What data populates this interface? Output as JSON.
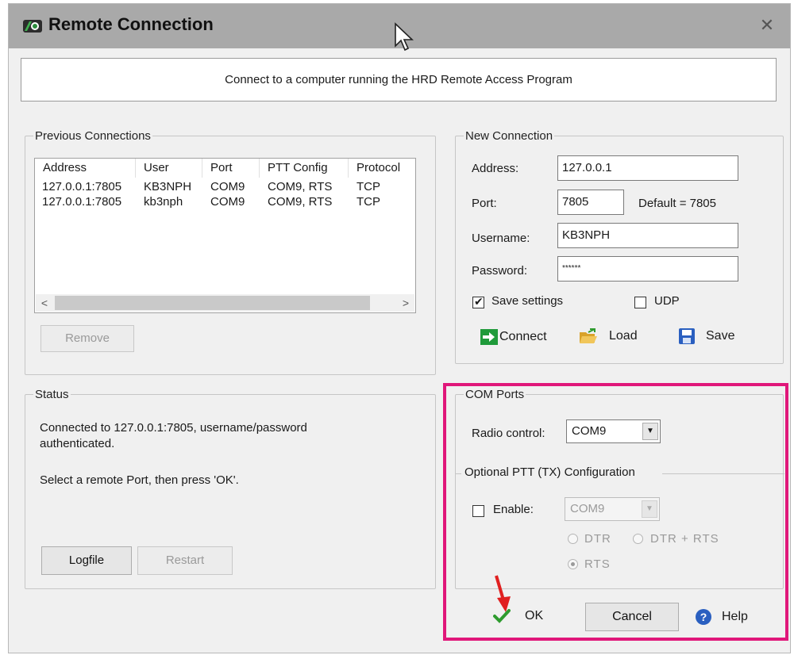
{
  "window": {
    "title": "Remote Connection",
    "close_glyph": "✕"
  },
  "banner": {
    "text": "Connect to a computer running the HRD Remote Access Program"
  },
  "previous_connections": {
    "legend": "Previous Connections",
    "columns": [
      "Address",
      "User",
      "Port",
      "PTT Config",
      "Protocol"
    ],
    "rows": [
      [
        "127.0.0.1:7805",
        "KB3NPH",
        "COM9",
        "COM9, RTS",
        "TCP"
      ],
      [
        "127.0.0.1:7805",
        "kb3nph",
        "COM9",
        "COM9, RTS",
        "TCP"
      ]
    ],
    "scroll_left": "<",
    "scroll_right": ">",
    "remove_label": "Remove"
  },
  "new_connection": {
    "legend": "New Connection",
    "address_label": "Address:",
    "address_value": "127.0.0.1",
    "port_label": "Port:",
    "port_value": "7805",
    "port_default": "Default = 7805",
    "username_label": "Username:",
    "username_value": "KB3NPH",
    "password_label": "Password:",
    "password_value": "******",
    "save_settings_label": "Save settings",
    "save_settings_checked": true,
    "udp_label": "UDP",
    "udp_checked": false,
    "connect_label": "Connect",
    "load_label": "Load",
    "save_label": "Save"
  },
  "status": {
    "legend": "Status",
    "line1": "Connected to 127.0.0.1:7805, username/password",
    "line2": "authenticated.",
    "line3": "Select a remote Port, then press 'OK'.",
    "logfile_label": "Logfile",
    "restart_label": "Restart"
  },
  "com_ports": {
    "legend": "COM Ports",
    "radio_control_label": "Radio control:",
    "radio_control_value": "COM9",
    "ptt_legend": "Optional PTT (TX) Configuration",
    "enable_label": "Enable:",
    "enable_checked": false,
    "ptt_port_value": "COM9",
    "dtr_label": "DTR",
    "dtr_rts_label": "DTR + RTS",
    "rts_label": "RTS",
    "selected_mode": "RTS"
  },
  "footer": {
    "ok_label": "OK",
    "cancel_label": "Cancel",
    "help_label": "Help"
  },
  "colors": {
    "highlight": "#e0177a",
    "arrow": "#e02020",
    "ok_check": "#2e9b2e",
    "connect_icon": "#1f9a3a",
    "help_icon": "#2a5fc0"
  }
}
